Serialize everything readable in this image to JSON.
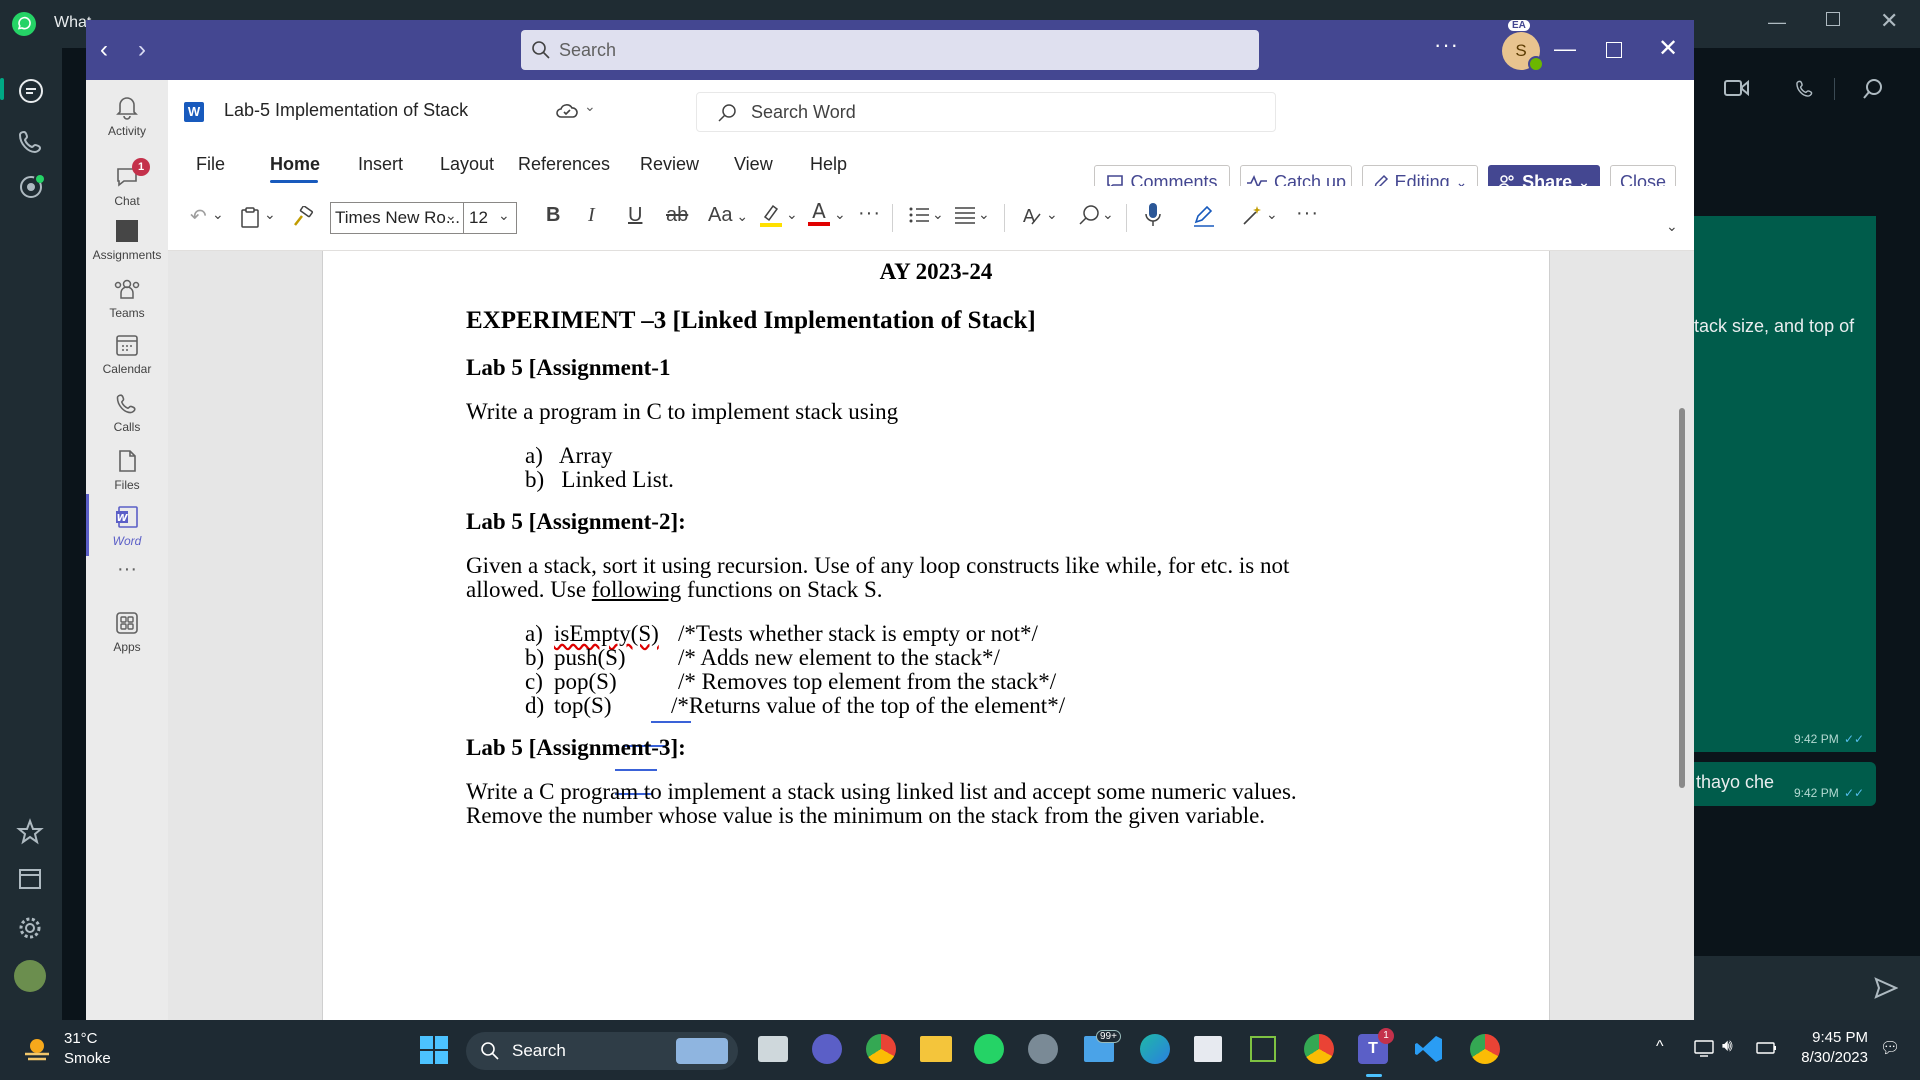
{
  "whatsapp": {
    "title": "What",
    "chat_snippet": "tack size, and top of",
    "msg_time_1": "9:42 PM",
    "msg_text_2": "thayo che",
    "msg_time_2": "9:42 PM"
  },
  "teams": {
    "search_placeholder": "Search",
    "account_badge": "EA",
    "avatar_letter": "S",
    "rail": [
      {
        "label": "Activity"
      },
      {
        "label": "Chat",
        "badge": "1"
      },
      {
        "label": "Assignments"
      },
      {
        "label": "Teams"
      },
      {
        "label": "Calendar"
      },
      {
        "label": "Calls"
      },
      {
        "label": "Files"
      },
      {
        "label": "Word"
      },
      {
        "label": "Apps"
      }
    ]
  },
  "word": {
    "doc_title": "Lab-5 Implementation of Stack",
    "search_placeholder": "Search Word",
    "menu": [
      "File",
      "Home",
      "Insert",
      "Layout",
      "References",
      "Review",
      "View",
      "Help"
    ],
    "buttons": {
      "comments": "Comments",
      "catch_up": "Catch up",
      "editing": "Editing",
      "share": "Share",
      "close": "Close"
    },
    "font_name": "Times New Ro...",
    "font_size": "12",
    "change_case": "Aa"
  },
  "document": {
    "year": "AY 2023-24",
    "experiment": "EXPERIMENT –3 [Linked Implementation of Stack]",
    "a1_heading": "Lab 5 [Assignment-1",
    "a1_text": "Write a program in C to implement stack using",
    "a1_items": [
      "a)  Array",
      "b)  Linked List."
    ],
    "a2_heading": "Lab 5 [Assignment-2]:",
    "a2_text_1": "Given a stack, sort it using recursion. Use of any loop constructs like while, for etc. is not",
    "a2_text_2a": "allowed. Use ",
    "a2_text_2b": "following",
    "a2_text_2c": " functions on Stack S.",
    "a2_items": [
      {
        "label": "a)",
        "fn": "isEmpty(S)",
        "comment": "/*Tests whether stack is empty or not*/"
      },
      {
        "label": "b)",
        "fn": "push(S)",
        "comment": "/* Adds new element to the stack*/"
      },
      {
        "label": "c)",
        "fn": "pop(S)",
        "comment": "/* Removes top element from the stack*/"
      },
      {
        "label": "d)",
        "fn": "top(S)",
        "comment": "/*Returns value of the top of the element*/"
      }
    ],
    "a3_heading": "Lab 5 [Assignment-3]:",
    "a3_text_1": "Write a C program to implement a stack using linked list and accept some numeric values.",
    "a3_text_2": "Remove the number whose value is the minimum on the stack from the given variable."
  },
  "taskbar": {
    "weather_temp": "31°C",
    "weather_desc": "Smoke",
    "search": "Search",
    "mail_badge": "99+",
    "teams_badge": "1",
    "time": "9:45 PM",
    "date": "8/30/2023"
  },
  "colors": {
    "teams_purple": "#444791",
    "word_blue": "#185abd",
    "whatsapp_green": "#005c4b",
    "badge_red": "#c4314b"
  }
}
